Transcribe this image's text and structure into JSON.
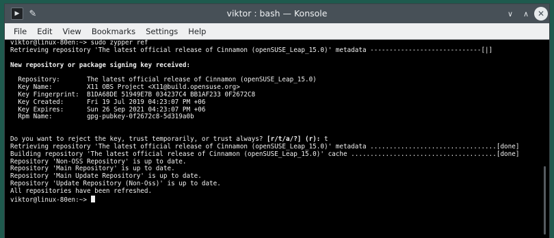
{
  "window": {
    "title": "viktor : bash — Konsole",
    "app_icon": "terminal-icon",
    "pin_icon": "pin-icon",
    "minimize_icon": "chevron-down-icon",
    "maximize_icon": "chevron-up-icon",
    "close_icon": "close-icon",
    "min_glyph": "∨",
    "max_glyph": "∧",
    "close_glyph": "✕",
    "app_glyph": "▶",
    "pin_glyph": "✎"
  },
  "menu": {
    "file": "File",
    "edit": "Edit",
    "view": "View",
    "bookmarks": "Bookmarks",
    "settings": "Settings",
    "help": "Help"
  },
  "terminal": {
    "lines": [
      "viktor@linux-80en:~> sudo zypper ref",
      "Retrieving repository 'The latest official release of Cinnamon (openSUSE_Leap_15.0)' metadata -----------------------------[|]",
      "",
      "New repository or package signing key received:",
      "",
      "  Repository:       The latest official release of Cinnamon (openSUSE_Leap_15.0)",
      "  Key Name:         X11 OBS Project <X11@build.opensuse.org>",
      "  Key Fingerprint:  B1DA68DE 51949E7B 034237C4 BB1AF233 0F2672C8",
      "  Key Created:      Fri 19 Jul 2019 04:23:07 PM +06",
      "  Key Expires:      Sun 26 Sep 2021 04:23:07 PM +06",
      "  Rpm Name:         gpg-pubkey-0f2672c8-5d319a0b",
      "",
      "",
      "",
      "Retrieving repository 'The latest official release of Cinnamon (openSUSE_Leap_15.0)' metadata .................................[done]",
      "Building repository 'The latest official release of Cinnamon (openSUSE_Leap_15.0)' cache ......................................[done]",
      "Repository 'Non-OSS Repository' is up to date.",
      "Repository 'Main Repository' is up to date.",
      "Repository 'Main Update Repository' is up to date.",
      "Repository 'Update Repository (Non-Oss)' is up to date.",
      "All repositories have been refreshed."
    ],
    "prompt_question": "Do you want to reject the key, trust temporarily, or trust always?",
    "prompt_options": "[r/t/a/?] (r):",
    "prompt_answer": "t",
    "final_prompt": "viktor@linux-80en:~>"
  }
}
